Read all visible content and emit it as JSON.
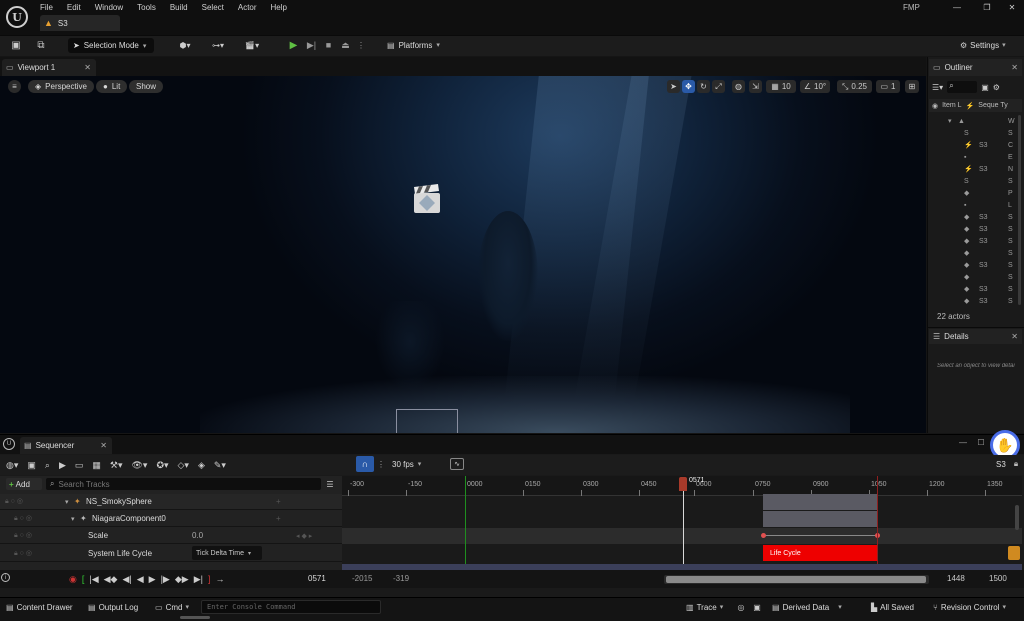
{
  "menu": {
    "items": [
      "File",
      "Edit",
      "Window",
      "Tools",
      "Build",
      "Select",
      "Actor",
      "Help"
    ],
    "project": "FMP"
  },
  "level_tab": {
    "label": "S3"
  },
  "toolbar": {
    "selection_mode": "Selection Mode",
    "platforms": "Platforms",
    "settings": "Settings"
  },
  "viewport": {
    "tab": "Viewport 1",
    "perspective": "Perspective",
    "lit": "Lit",
    "show": "Show",
    "grid_size": "10",
    "rotation_snap": "10°",
    "scale_snap": "0.25",
    "camera_speed": "1"
  },
  "outliner": {
    "tab": "Outliner",
    "col_item": "Item L",
    "col_seq": "Seque Ty",
    "rows": [
      {
        "seq": "",
        "type": "W"
      },
      {
        "seq": "",
        "type": "S"
      },
      {
        "seq": "S3",
        "type": "C"
      },
      {
        "seq": "",
        "type": "E"
      },
      {
        "seq": "S3",
        "type": "N"
      },
      {
        "seq": "",
        "type": "S"
      },
      {
        "seq": "",
        "type": "P"
      },
      {
        "seq": "",
        "type": "L"
      },
      {
        "seq": "S3",
        "type": "S"
      },
      {
        "seq": "S3",
        "type": "S"
      },
      {
        "seq": "S3",
        "type": "S"
      },
      {
        "seq": "",
        "type": "S"
      },
      {
        "seq": "S3",
        "type": "S"
      },
      {
        "seq": "",
        "type": "S"
      },
      {
        "seq": "S3",
        "type": "S"
      },
      {
        "seq": "S3",
        "type": "S"
      }
    ],
    "count": "22 actors"
  },
  "details": {
    "tab": "Details",
    "hint": "Select an object to view detai"
  },
  "sequencer": {
    "tab": "Sequencer",
    "add": "Add",
    "search_placeholder": "Search Tracks",
    "fps": "30 fps",
    "seq_name": "S3",
    "tracks": [
      {
        "name": "NS_SmokySphere"
      },
      {
        "name": "NiagaraComponent0"
      },
      {
        "name": "Scale",
        "value": "0.0"
      },
      {
        "name": "System Life Cycle",
        "value": "Tick Delta Time"
      }
    ],
    "ruler": [
      "-300",
      "-150",
      "0000",
      "0150",
      "0300",
      "0450",
      "0600",
      "0750",
      "0900",
      "1050",
      "1200",
      "1350"
    ],
    "playhead": "0571",
    "current_frame": "0571",
    "range_start": "-2015",
    "view_start": "-319",
    "view_end": "1448",
    "range_end": "1500",
    "section_label": "Life Cycle"
  },
  "statusbar": {
    "content_drawer": "Content Drawer",
    "output_log": "Output Log",
    "cmd": "Cmd",
    "console_placeholder": "Enter Console Command",
    "trace": "Trace",
    "derived_data": "Derived Data",
    "all_saved": "All Saved",
    "revision_control": "Revision Control"
  }
}
